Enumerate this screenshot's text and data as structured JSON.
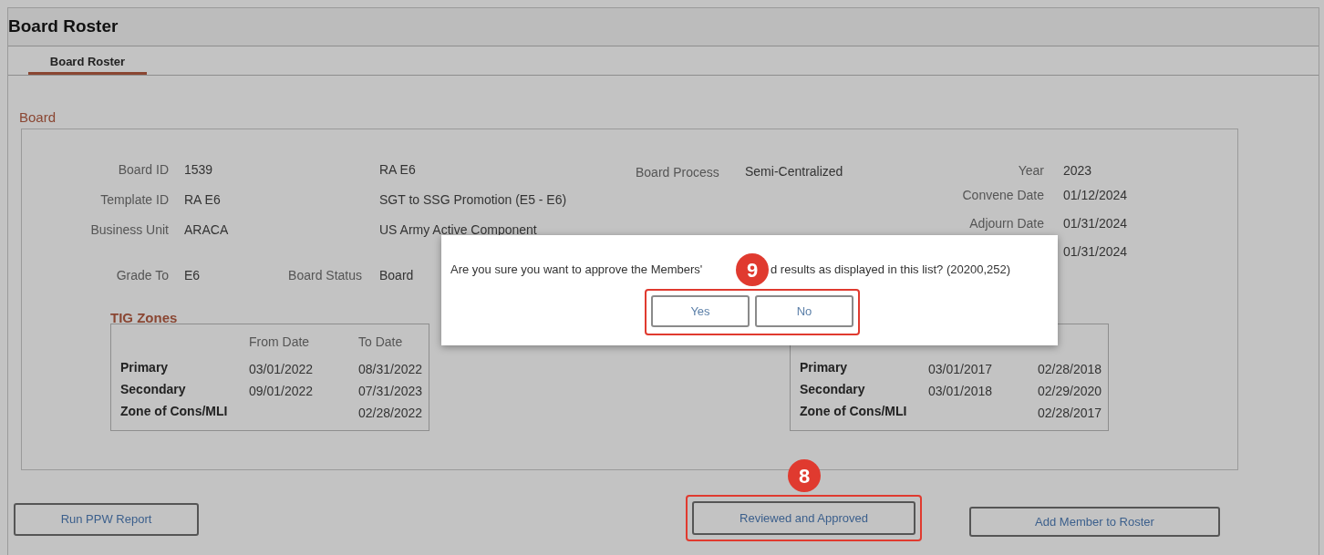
{
  "window": {
    "title": "Board Roster"
  },
  "tabs": [
    {
      "label": "Board Roster",
      "selected": true
    }
  ],
  "section_title": "Board",
  "left_fields": [
    {
      "label": "Board ID",
      "value": "1539",
      "description": "RA E6"
    },
    {
      "label": "Template ID",
      "value": "RA E6",
      "description": "SGT to SSG Promotion (E5 - E6)"
    },
    {
      "label": "Business Unit",
      "value": "ARACA",
      "description": "US Army Active Component"
    }
  ],
  "board_process": {
    "label": "Board Process",
    "value": "Semi-Centralized"
  },
  "date_fields": [
    {
      "label": "Year",
      "value": "2023"
    },
    {
      "label": "Convene Date",
      "value": "01/12/2024"
    },
    {
      "label": "Adjourn Date",
      "value": "01/31/2024"
    },
    {
      "value": "01/31/2024"
    }
  ],
  "grade_to": {
    "label": "Grade To",
    "value": "E6"
  },
  "board_status": {
    "label": "Board Status",
    "value": "Board"
  },
  "tig_zones": {
    "title": "TIG Zones",
    "columns": [
      "From Date",
      "To Date"
    ],
    "rows": [
      {
        "zone": "Primary",
        "from": "03/01/2022",
        "to": "08/31/2022"
      },
      {
        "zone": "Secondary",
        "from": "09/01/2022",
        "to": "07/31/2023"
      },
      {
        "zone": "Zone of Cons/MLI",
        "to": "02/28/2022"
      }
    ]
  },
  "second_zones": {
    "rows": [
      {
        "zone": "Primary",
        "from": "03/01/2017",
        "to": "02/28/2018"
      },
      {
        "zone": "Secondary",
        "from": "03/01/2018",
        "to": "02/29/2020"
      },
      {
        "zone": "Zone of Cons/MLI",
        "to": "02/28/2017"
      }
    ]
  },
  "buttons": [
    {
      "label": "Run PPW Report",
      "highlighted": false
    },
    {
      "label": "Reviewed and Approved",
      "highlighted": true
    },
    {
      "label": "Add Member to Roster",
      "highlighted": false
    }
  ],
  "dialog": {
    "message_parts": [
      "Are you sure you want to approve the Members'",
      "d results as displayed in this list? (20200,252)"
    ],
    "buttons": [
      "Yes",
      "No"
    ]
  },
  "callouts": [
    {
      "number": "9"
    },
    {
      "number": "8"
    }
  ]
}
